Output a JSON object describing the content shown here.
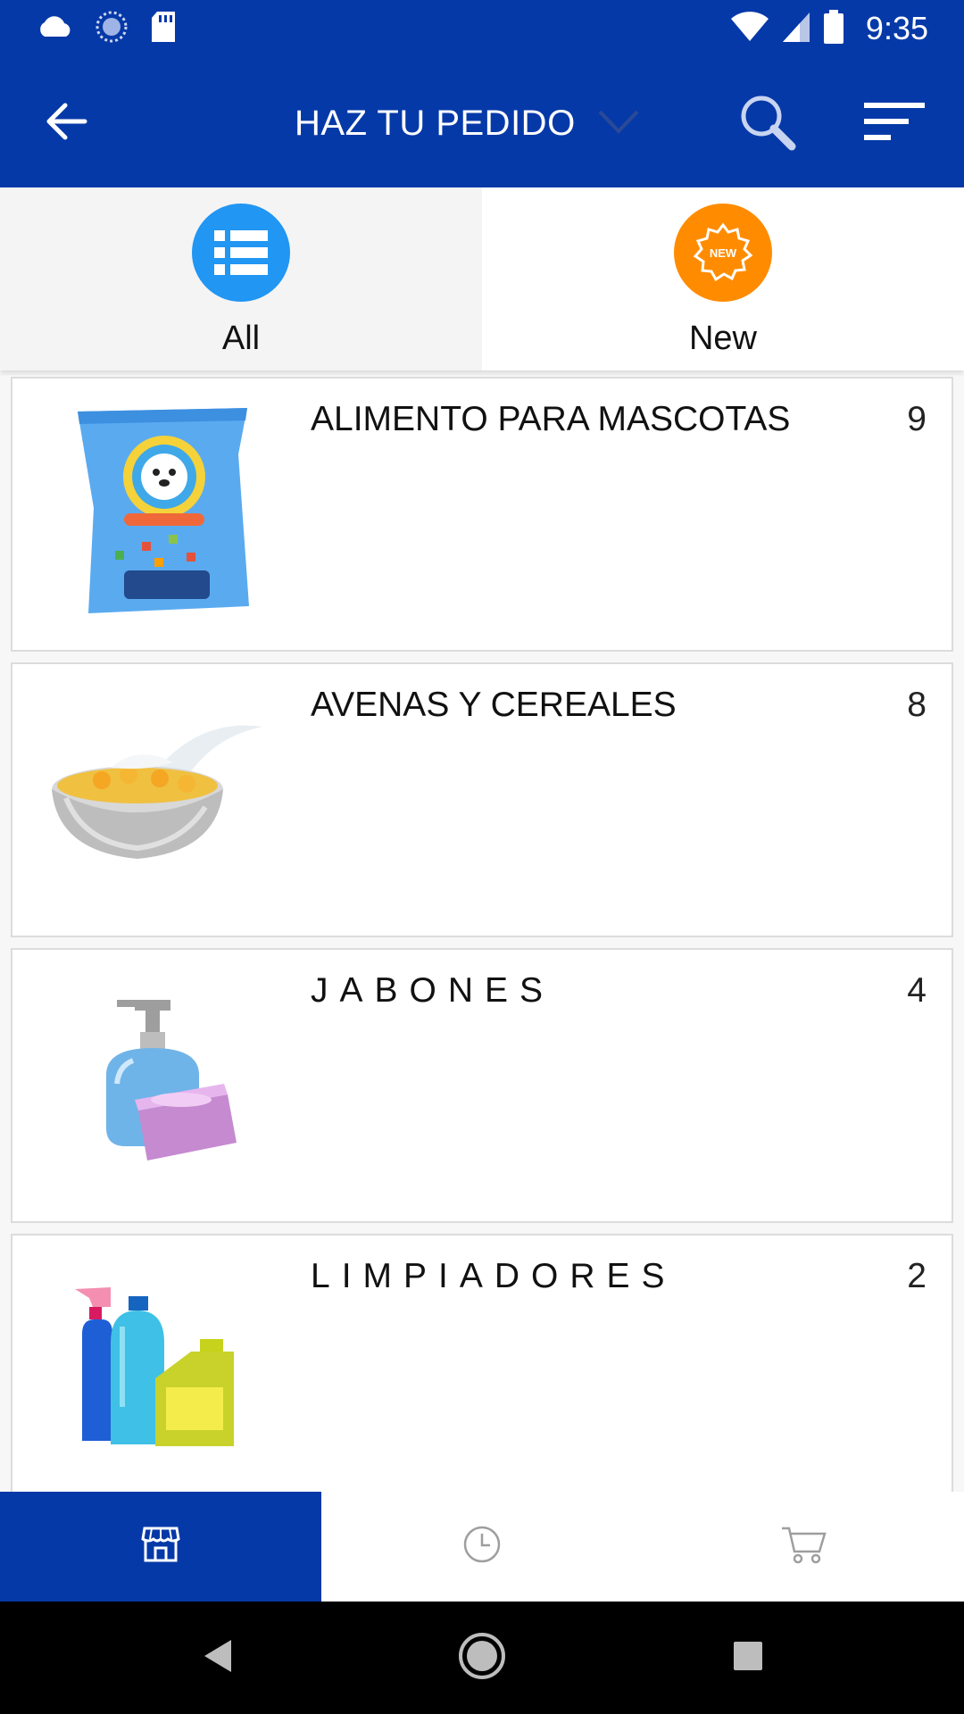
{
  "status_bar": {
    "time": "9:35",
    "icons": [
      "cloud-icon",
      "sync-icon",
      "sd-card-icon",
      "wifi-icon",
      "signal-icon",
      "battery-icon"
    ]
  },
  "app_bar": {
    "title": "HAZ TU PEDIDO",
    "icons": [
      "back-arrow-icon",
      "chevron-down-icon",
      "search-icon",
      "filter-icon"
    ],
    "color": "#0639a8"
  },
  "tabs": [
    {
      "label": "All",
      "icon": "list-icon",
      "color": "#2196f3",
      "active": true
    },
    {
      "label": "New",
      "icon": "new-badge-icon",
      "color": "#ff8c00",
      "badge_text": "NEW",
      "active": false
    }
  ],
  "categories": [
    {
      "name": "ALIMENTO PARA MASCOTAS",
      "count": "9",
      "image": "pet-food-bag"
    },
    {
      "name": "AVENAS Y CEREALES",
      "count": "8",
      "image": "cereal-bowl"
    },
    {
      "name": "JABONES",
      "count": "4",
      "image": "soap"
    },
    {
      "name": "LIMPIADORES",
      "count": "2",
      "image": "cleaning-bottles"
    }
  ],
  "bottom_nav": {
    "items": [
      "store-icon",
      "clock-icon",
      "cart-icon"
    ],
    "active": "store-icon"
  },
  "system_nav": [
    "back-triangle-icon",
    "home-circle-icon",
    "recents-square-icon"
  ]
}
